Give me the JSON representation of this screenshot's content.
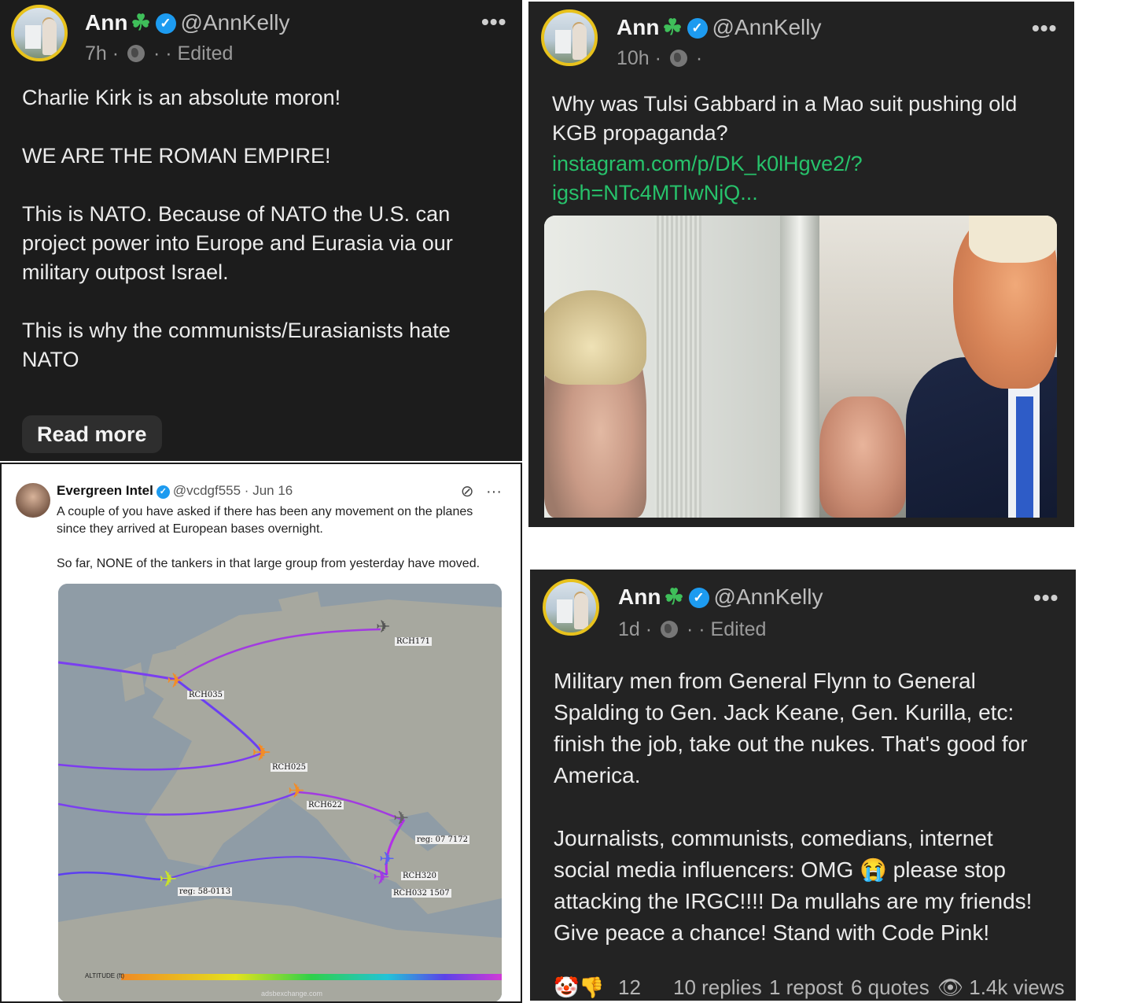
{
  "post1": {
    "name": "Ann",
    "handle": "@AnnKelly",
    "time": "7h",
    "edited": "· Edited",
    "text": "Charlie Kirk is an absolute moron!\n\nWE ARE THE ROMAN EMPIRE!\n\nThis is NATO. Because of NATO the U.S. can\nproject power into Europe and Eurasia via our\nmilitary outpost Israel.\n\nThis is why the communists/Eurasianists hate\nNATO",
    "read_more": "Read more"
  },
  "post2": {
    "name": "Ann",
    "handle": "@AnnKelly",
    "time": "10h",
    "text": "Why was Tulsi Gabbard in a Mao suit pushing old\nKGB propaganda?",
    "link": "instagram.com/p/DK_k0lHgve2/?\nigsh=NTc4MTIwNjQ..."
  },
  "post3": {
    "name": "Ann",
    "handle": "@AnnKelly",
    "time": "1d",
    "edited": "· Edited",
    "text": "Military men from General Flynn to General\nSpalding to Gen. Jack Keane, Gen. Kurilla, etc:\nfinish the job, take out the nukes. That's good for\nAmerica.\n\nJournalists, communists, comedians, internet\nsocial media influencers: OMG 😭 please stop\nattacking the IRGC!!!! Da mullahs are my friends!\nGive peace a chance! Stand with Code Pink!",
    "reactions_emoji": "🤡👎",
    "reactions_count": "12",
    "replies": "10 replies",
    "reposts": "1 repost",
    "quotes": "6 quotes",
    "views": "1.4k views"
  },
  "embedded_tweet": {
    "name": "Evergreen Intel",
    "handle": "@vcdgf555 · Jun 16",
    "line1": "A couple of you have asked if there has been any movement on the planes",
    "line2": "since they arrived at European bases overnight.",
    "line3": "So far, NONE of the tankers in that large group from yesterday have moved.",
    "map_labels": [
      "RCH171",
      "RCH035",
      "RCH025",
      "RCH622",
      "RCH320",
      "RCH032 1507",
      "reg: 07 7172",
      "reg: 58-0113"
    ],
    "altitude_label": "ALTITUDE (ft)",
    "map_source": "adsbexchange.com"
  },
  "colors": {
    "verified": "#1d9bf0",
    "link": "#27c26b",
    "avatar_ring": "#e8c21c"
  }
}
